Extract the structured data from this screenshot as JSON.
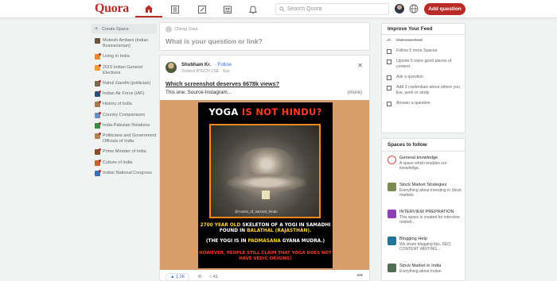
{
  "header": {
    "logo": "Quora",
    "search_placeholder": "Search Quora",
    "add_question": "Add question"
  },
  "sidebar": {
    "create_space": "Create Space",
    "items": [
      {
        "label": "Mukesh Ambani (Indian Businessman)",
        "color": "#6b5343",
        "dot": false
      },
      {
        "label": "Living in India",
        "color": "#e88a2b",
        "dot": true
      },
      {
        "label": "2019 Indian General Elections",
        "color": "#ff9933",
        "dot": true
      },
      {
        "label": "Rahul Gandhi (politician)",
        "color": "#7a6652",
        "dot": true
      },
      {
        "label": "Indian Air Force (IAF)",
        "color": "#2c4e7a",
        "dot": true
      },
      {
        "label": "History of India",
        "color": "#a4794b",
        "dot": true
      },
      {
        "label": "Country Comparisons",
        "color": "#6c8ebf",
        "dot": true
      },
      {
        "label": "India-Pakistan Relations",
        "color": "#3b8a3e",
        "dot": true
      },
      {
        "label": "Politicians and Government Officials of India",
        "color": "#b08350",
        "dot": true
      },
      {
        "label": "Prime Minister of India",
        "color": "#8a4b2a",
        "dot": true
      },
      {
        "label": "Culture of India",
        "color": "#c9602b",
        "dot": true
      },
      {
        "label": "Indian National Congress",
        "color": "#3b6fb5",
        "dot": true
      }
    ]
  },
  "ask": {
    "user": "Chirag Gaur",
    "prompt": "What is your question or link?"
  },
  "post": {
    "author": "Shubham Kr.",
    "follow": "· Follow",
    "credential": "Student BTECH CSE · Sun",
    "title": "Which screenshot deserves 6678k views?",
    "snippet": "This one. Source-Instagram...",
    "more": "(more)",
    "poster": {
      "title_a": "YOGA ",
      "title_b": "IS NOT HINDU?",
      "handle": "@roasts_of_sarcast_hindu",
      "line1_a": "2700 YEAR OLD ",
      "line1_b": "SKELETON OF A YOGI IN SAMADHI FOUND IN ",
      "line1_c": "BALATHAL (RAJASTHAN).",
      "line2_a": "(THE YOGI IS IN ",
      "line2_b": "PADMASANA",
      "line2_c": " GYANA MUDRA.)",
      "line3": "HOWEVER, PEOPLE STILL CLAIM THAT YOGA DOES NOT HAVE VEDIC ORIGINS!"
    },
    "upvotes": "1.2K",
    "comments": "41"
  },
  "feed": {
    "title": "Improve Your Feed",
    "items": [
      {
        "label": "Visit your feed",
        "done": true
      },
      {
        "label": "Follow 5 more Spaces",
        "done": false
      },
      {
        "label": "Upvote 5 more good pieces of content",
        "done": false
      },
      {
        "label": "Ask a question",
        "done": false
      },
      {
        "label": "Add 3 credentials about where you live, work or study",
        "done": false
      },
      {
        "label": "Answer a question",
        "done": false
      }
    ]
  },
  "spaces": {
    "title": "Spaces to follow",
    "items": [
      {
        "name": "General knowledge",
        "desc": "A space which enables our knowledge.",
        "color": "#e04848",
        "icon": "circle-icon"
      },
      {
        "name": "Stock Market Strategies",
        "desc": "Everything about investing in Stock markets",
        "color": "#7a8a52",
        "icon": "photo-icon"
      },
      {
        "name": "INTERVIEW PREPRATION",
        "desc": "This space is created for interview related...",
        "color": "#8e3fb8",
        "icon": "briefcase-icon"
      },
      {
        "name": "Blogging Help",
        "desc": "We share blogging tips, SEO, CONTENT WRITING...",
        "color": "#21759b",
        "icon": "wordpress-icon"
      },
      {
        "name": "Stock Market in India",
        "desc": "Everything about Indian",
        "color": "#4f6e52",
        "icon": "chart-icon"
      }
    ]
  }
}
